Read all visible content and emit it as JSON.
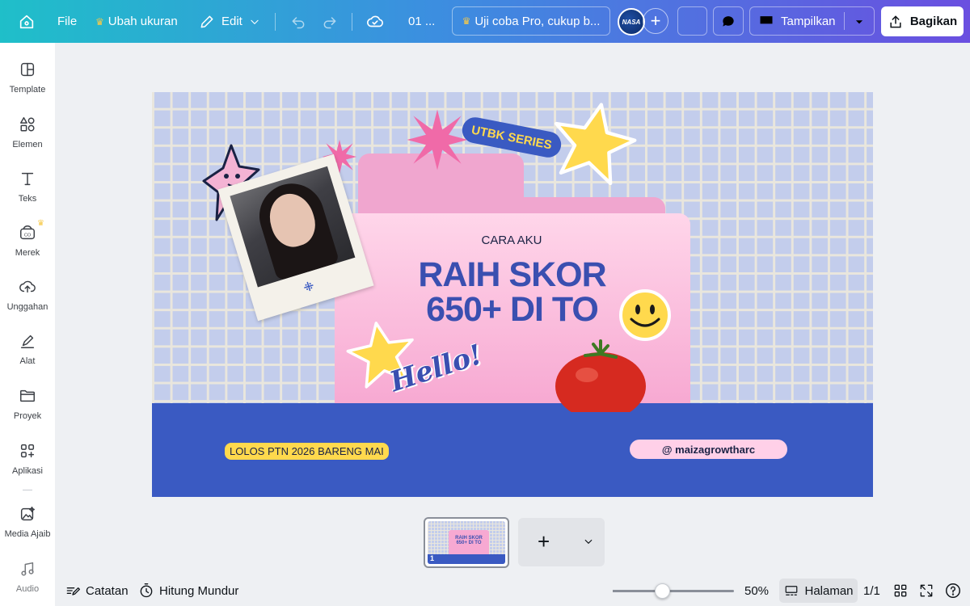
{
  "topbar": {
    "file": "File",
    "resize": "Ubah ukuran",
    "edit": "Edit",
    "page_label": "01 ...",
    "promo": "Uji coba Pro, cukup b...",
    "avatar_text": "NASA",
    "present": "Tampilkan",
    "share": "Bagikan"
  },
  "sidebar": {
    "items": [
      {
        "label": "Template",
        "icon": "template-icon"
      },
      {
        "label": "Elemen",
        "icon": "elements-icon"
      },
      {
        "label": "Teks",
        "icon": "text-icon"
      },
      {
        "label": "Merek",
        "icon": "brand-icon"
      },
      {
        "label": "Unggahan",
        "icon": "upload-icon"
      },
      {
        "label": "Alat",
        "icon": "tools-icon"
      },
      {
        "label": "Proyek",
        "icon": "folder-icon"
      },
      {
        "label": "Aplikasi",
        "icon": "apps-icon"
      },
      {
        "label": "Media Ajaib",
        "icon": "magic-media-icon"
      },
      {
        "label": "Audio",
        "icon": "audio-icon"
      }
    ]
  },
  "design": {
    "series_badge": "UTBK SERIES",
    "pre_headline": "CARA AKU",
    "headline_line1": "RAIH SKOR",
    "headline_line2": "650+ DI TO",
    "sticker_hello": "Hello!",
    "tag_left": "LOLOS PTN 2026 BARENG MAI",
    "tag_right": "@ maizagrowtharc",
    "colors": {
      "grid_bg": "#c3cdec",
      "band": "#3a5ac2",
      "folder": "#f7a9d2",
      "headline": "#3a4fb0",
      "yellow": "#ffd94d"
    }
  },
  "pages": {
    "thumb_number": "1",
    "thumb_line1": "RAIH SKOR",
    "thumb_line2": "650+ DI TO"
  },
  "bottombar": {
    "notes": "Catatan",
    "timer": "Hitung Mundur",
    "zoom_percent": 50,
    "zoom": "50%",
    "page_view": "Halaman",
    "page_count": "1/1"
  }
}
